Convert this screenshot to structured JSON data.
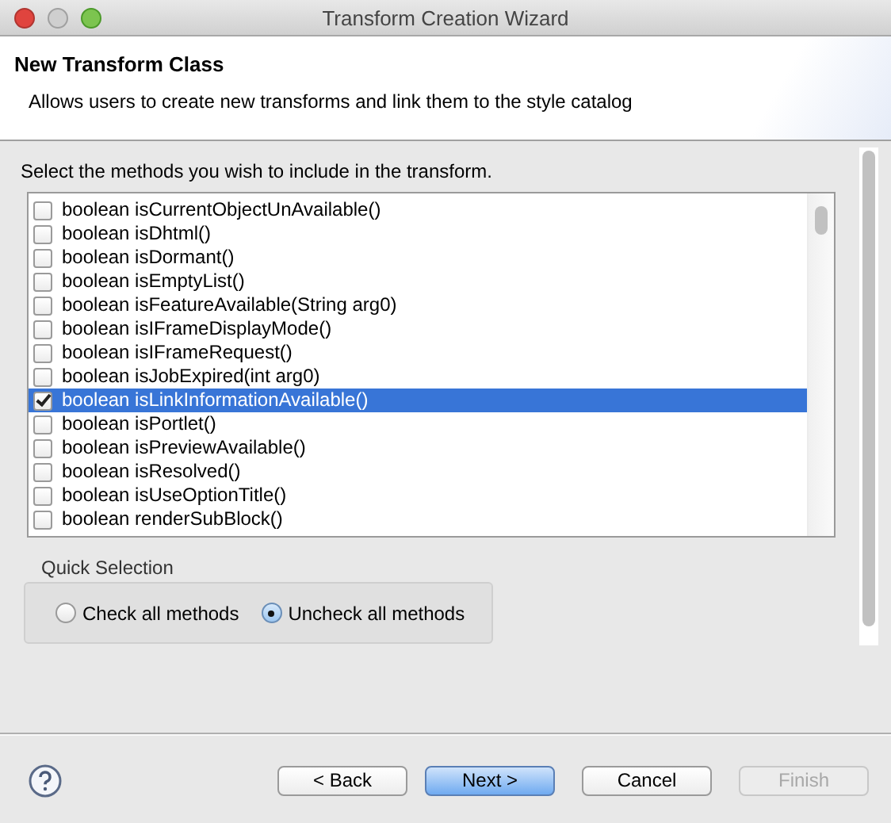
{
  "window": {
    "title": "Transform Creation Wizard"
  },
  "header": {
    "title": "New Transform Class",
    "description": "Allows users to create new transforms and link them to the style catalog"
  },
  "instruction": "Select the methods you wish to include in the transform.",
  "methods": [
    {
      "label": "boolean isCurrentObjectUnAvailable()",
      "checked": false,
      "selected": false
    },
    {
      "label": "boolean isDhtml()",
      "checked": false,
      "selected": false
    },
    {
      "label": "boolean isDormant()",
      "checked": false,
      "selected": false
    },
    {
      "label": "boolean isEmptyList()",
      "checked": false,
      "selected": false
    },
    {
      "label": "boolean isFeatureAvailable(String arg0)",
      "checked": false,
      "selected": false
    },
    {
      "label": "boolean isIFrameDisplayMode()",
      "checked": false,
      "selected": false
    },
    {
      "label": "boolean isIFrameRequest()",
      "checked": false,
      "selected": false
    },
    {
      "label": "boolean isJobExpired(int arg0)",
      "checked": false,
      "selected": false
    },
    {
      "label": "boolean isLinkInformationAvailable()",
      "checked": true,
      "selected": true
    },
    {
      "label": "boolean isPortlet()",
      "checked": false,
      "selected": false
    },
    {
      "label": "boolean isPreviewAvailable()",
      "checked": false,
      "selected": false
    },
    {
      "label": "boolean isResolved()",
      "checked": false,
      "selected": false
    },
    {
      "label": "boolean isUseOptionTitle()",
      "checked": false,
      "selected": false
    },
    {
      "label": "boolean renderSubBlock()",
      "checked": false,
      "selected": false
    }
  ],
  "quick_selection": {
    "title": "Quick Selection",
    "options": [
      {
        "label": "Check all methods",
        "selected": false
      },
      {
        "label": "Uncheck all methods",
        "selected": true
      }
    ]
  },
  "buttons": [
    {
      "label": "< Back",
      "kind": "normal",
      "disabled": false
    },
    {
      "label": "Next >",
      "kind": "default",
      "disabled": false
    },
    {
      "label": "Cancel",
      "kind": "normal",
      "disabled": false
    },
    {
      "label": "Finish",
      "kind": "normal",
      "disabled": true
    }
  ]
}
